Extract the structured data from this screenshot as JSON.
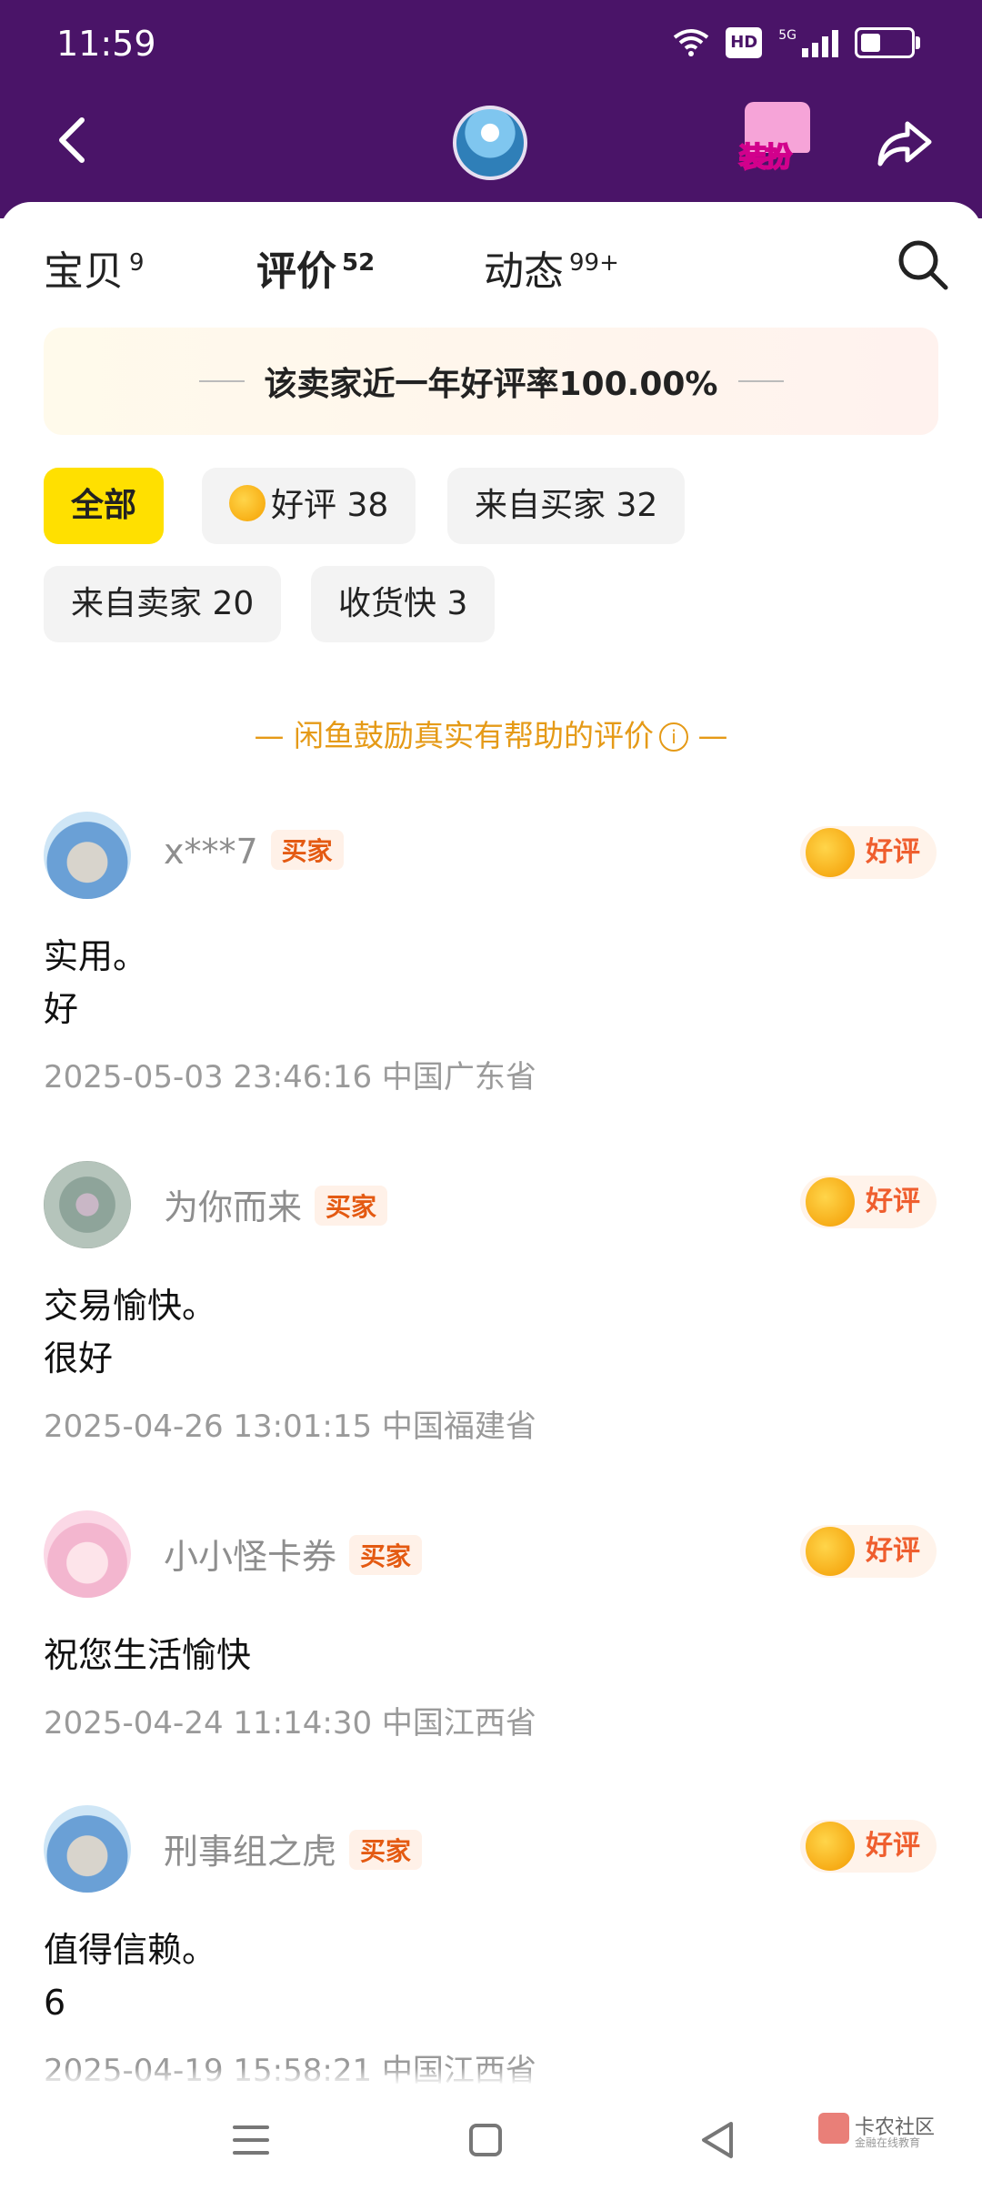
{
  "status_bar": {
    "time": "11:59",
    "hd": "HD",
    "network": "5G",
    "battery_level": 0.35
  },
  "header": {
    "dress_up_label": "装扮"
  },
  "tabs": [
    {
      "label": "宝贝",
      "count": "9"
    },
    {
      "label": "评价",
      "count": "52"
    },
    {
      "label": "动态",
      "count": "99+"
    }
  ],
  "rating_banner": "该卖家近一年好评率100.00%",
  "filters": [
    {
      "label": "全部"
    },
    {
      "label": "好评 38"
    },
    {
      "label": "来自买家 32"
    },
    {
      "label": "来自卖家 20"
    },
    {
      "label": "收货快 3"
    }
  ],
  "encourage_text": "— 闲鱼鼓励真实有帮助的评价",
  "encourage_info": "i",
  "encourage_tail": "—",
  "reviews": [
    {
      "name": "x***7",
      "role": "买家",
      "tag": "好评",
      "text": "实用。\n好",
      "time": "2025-05-03 23:46:16",
      "region": "中国广东省"
    },
    {
      "name": "为你而来",
      "role": "买家",
      "tag": "好评",
      "text": "交易愉快。\n很好",
      "time": "2025-04-26 13:01:15",
      "region": "中国福建省"
    },
    {
      "name": "小小怪卡券",
      "role": "买家",
      "tag": "好评",
      "text": "祝您生活愉快",
      "time": "2025-04-24 11:14:30",
      "region": "中国江西省"
    },
    {
      "name": "刑事组之虎",
      "role": "买家",
      "tag": "好评",
      "text": "值得信赖。\n6",
      "time": "2025-04-19 15:58:21",
      "region": "中国江西省"
    }
  ],
  "watermark": {
    "title": "卡农社区",
    "subtitle": "金融在线教育"
  },
  "colors": {
    "header_bg": "#4a1468",
    "accent_yellow": "#ffe000",
    "good_tag": "#ef5e2e",
    "badge": "#e45a12",
    "encourage": "#e59a17"
  }
}
